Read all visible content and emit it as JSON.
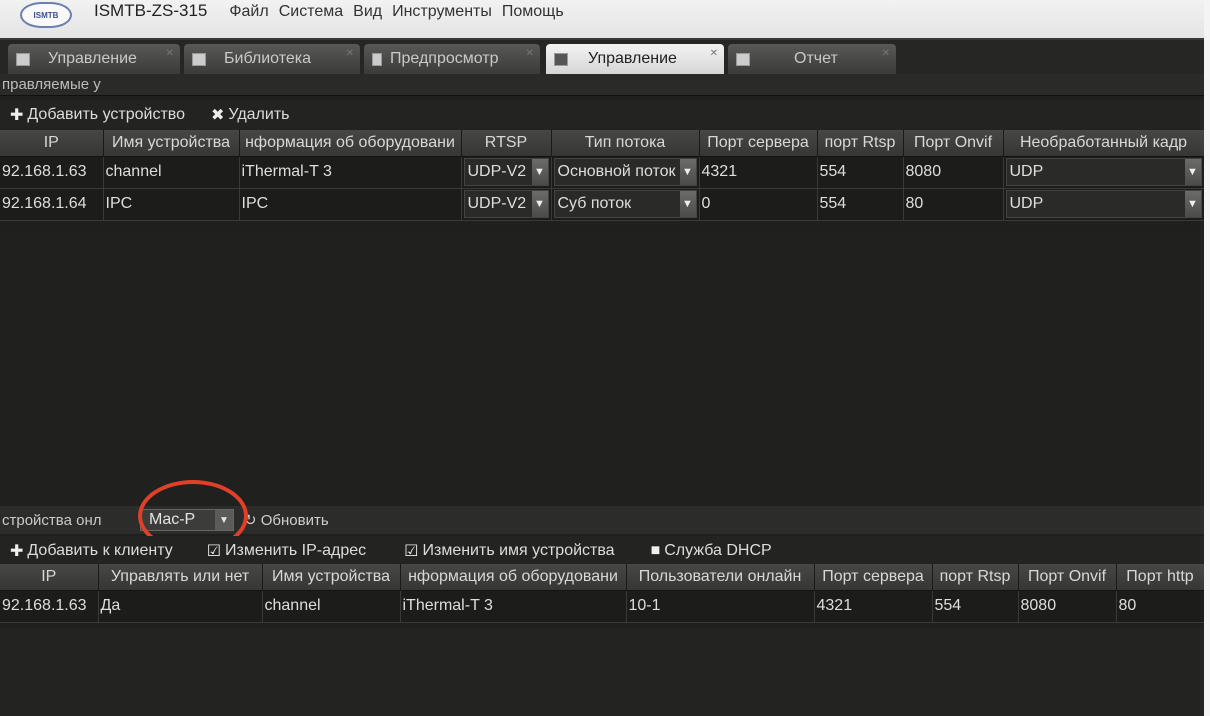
{
  "app": {
    "logo_text": "ISMTB",
    "title": "ISMTB-ZS-315",
    "menu": [
      "Файл",
      "Система",
      "Вид",
      "Инструменты",
      "Помощь"
    ]
  },
  "tabs": [
    {
      "label": "Управление",
      "active": false
    },
    {
      "label": "Библиотека",
      "active": false
    },
    {
      "label": "Предпросмотр",
      "active": false
    },
    {
      "label": "Управление",
      "active": true
    },
    {
      "label": "Отчет",
      "active": false
    }
  ],
  "managed": {
    "section_label": "правляемые у",
    "toolbar": {
      "add": "Добавить устройство",
      "delete": "Удалить"
    },
    "columns": [
      "IP",
      "Имя устройства",
      "нформация об оборудовани",
      "RTSP",
      "Тип потока",
      "Порт сервера",
      "порт Rtsp",
      "Порт Onvif",
      "Необработанный кадр"
    ],
    "rows": [
      {
        "ip": "92.168.1.63",
        "name": "channel",
        "info": "iThermal-T 3",
        "rtsp": "UDP-V2",
        "stream": "Основной поток",
        "server_port": "4321",
        "rtsp_port": "554",
        "onvif_port": "8080",
        "raw_frame": "UDP"
      },
      {
        "ip": "92.168.1.64",
        "name": "IPC",
        "info": "IPC",
        "rtsp": "UDP-V2",
        "stream": "Суб поток",
        "server_port": "0",
        "rtsp_port": "554",
        "onvif_port": "80",
        "raw_frame": "UDP"
      }
    ]
  },
  "online": {
    "label": "стройства онл",
    "filter_value": "Mac-P",
    "refresh": "Обновить",
    "toolbar": {
      "add_client": "Добавить к клиенту",
      "change_ip": "Изменить IP-адрес",
      "rename": "Изменить имя устройства",
      "dhcp": "Служба DHCP"
    },
    "columns": [
      "IP",
      "Управлять или нет",
      "Имя устройства",
      "нформация об оборудовани",
      "Пользователи онлайн",
      "Порт сервера",
      "порт Rtsp",
      "Порт Onvif",
      "Порт http"
    ],
    "rows": [
      {
        "ip": "92.168.1.63",
        "managed": "Да",
        "name": "channel",
        "info": "iThermal-T 3",
        "users": "10-1",
        "server_port": "4321",
        "rtsp_port": "554",
        "onvif_port": "8080",
        "http_port": "80"
      }
    ]
  },
  "colors": {
    "annotation": "#e0402a",
    "background": "#1f1f1d"
  }
}
